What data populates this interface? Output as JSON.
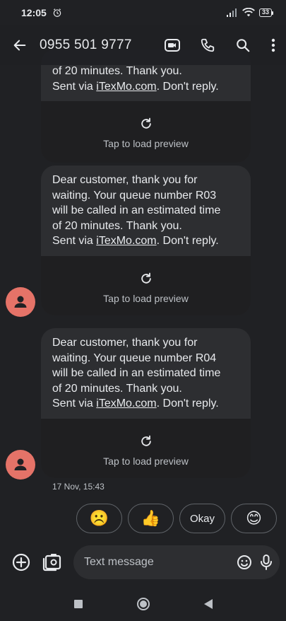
{
  "status_bar": {
    "time": "12:05",
    "battery": "33",
    "icons": [
      "alarm-icon",
      "signal-icon",
      "wifi-icon",
      "battery-icon"
    ]
  },
  "app_bar": {
    "title": "0955 501 9777",
    "icons": [
      "back-arrow-icon",
      "video-call-icon",
      "phone-icon",
      "search-icon",
      "more-vert-icon"
    ]
  },
  "conversation": {
    "messages": [
      {
        "lines_before_link": "of 20 minutes. Thank you.\nSent via ",
        "link": "iTexMo.com",
        "after_link": ". Don't reply.",
        "preview_label": "Tap to load preview"
      },
      {
        "lines_before_link": "Dear customer, thank you for\nwaiting. Your queue number R03\nwill be called  in an estimated time\nof 20 minutes. Thank you.\nSent via ",
        "link": "iTexMo.com",
        "after_link": ". Don't reply.",
        "preview_label": "Tap to load preview"
      },
      {
        "lines_before_link": "Dear customer, thank you for\nwaiting. Your queue number R04\nwill be called  in an estimated time\nof 20 minutes. Thank you.\nSent via ",
        "link": "iTexMo.com",
        "after_link": ". Don't reply.",
        "preview_label": "Tap to load preview"
      }
    ],
    "timestamp": "17 Nov, 15:43"
  },
  "smart_replies": [
    {
      "label": "☹️",
      "kind": "emoji"
    },
    {
      "label": "👍",
      "kind": "emoji"
    },
    {
      "label": "Okay",
      "kind": "text"
    },
    {
      "label": "😊",
      "kind": "emoji"
    }
  ],
  "compose": {
    "placeholder": "Text message",
    "icons": [
      "add-circle-icon",
      "gallery-icon",
      "emoji-icon",
      "mic-icon"
    ]
  },
  "nav_bar": {
    "icons": [
      "recents-icon",
      "home-icon",
      "back-icon"
    ]
  },
  "colors": {
    "background": "#202124",
    "bubble": "#2d2e31",
    "avatar": "#e57368",
    "text": "#e8eaed"
  }
}
